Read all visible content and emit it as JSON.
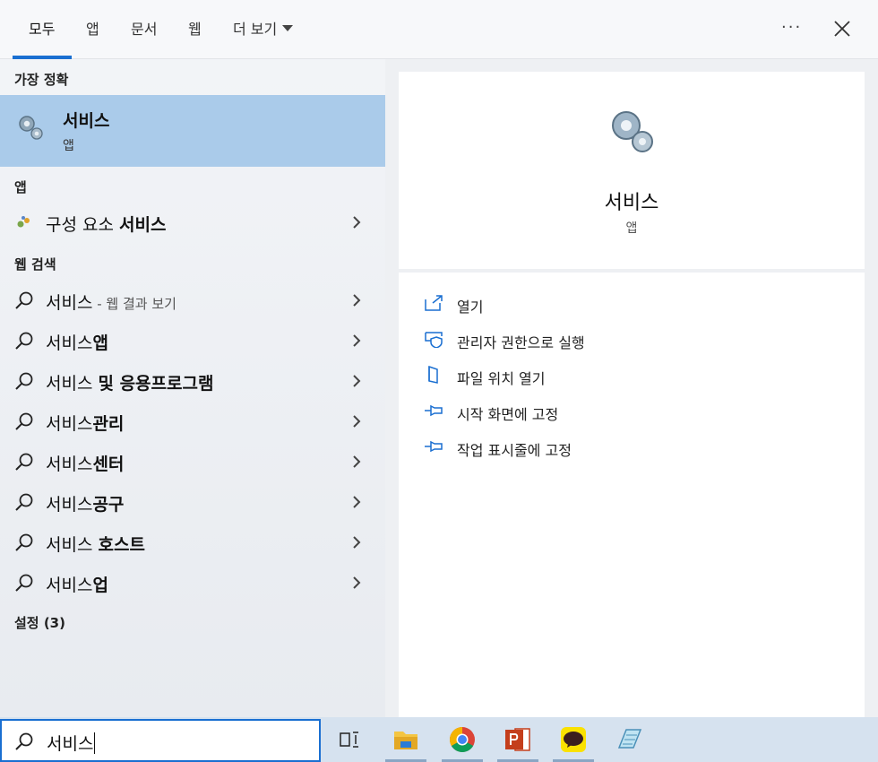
{
  "tabs": [
    {
      "label": "모두",
      "active": true
    },
    {
      "label": "앱"
    },
    {
      "label": "문서"
    },
    {
      "label": "웹"
    },
    {
      "label": "더 보기"
    }
  ],
  "more_label": "···",
  "sections": {
    "best": "가장 정확",
    "apps": "앱",
    "web": "웹 검색",
    "settings": "설정 (3)"
  },
  "best_match": {
    "title": "서비스",
    "subtitle": "앱"
  },
  "app_results": [
    {
      "prefix": "구성 요소 ",
      "bold": "서비스"
    }
  ],
  "web_results": [
    {
      "prefix": "서비스",
      "bold": "",
      "hint": " - 웹 결과 보기"
    },
    {
      "prefix": "서비스",
      "bold": "앱",
      "hint": ""
    },
    {
      "prefix": "서비스 ",
      "bold": "및 응용프로그램",
      "hint": ""
    },
    {
      "prefix": "서비스",
      "bold": "관리",
      "hint": ""
    },
    {
      "prefix": "서비스",
      "bold": "센터",
      "hint": ""
    },
    {
      "prefix": "서비스",
      "bold": "공구",
      "hint": ""
    },
    {
      "prefix": "서비스 ",
      "bold": "호스트",
      "hint": ""
    },
    {
      "prefix": "서비스",
      "bold": "업",
      "hint": ""
    }
  ],
  "preview": {
    "title": "서비스",
    "subtitle": "앱",
    "actions": [
      {
        "label": "열기",
        "icon": "open-icon"
      },
      {
        "label": "관리자 권한으로 실행",
        "icon": "shield-icon"
      },
      {
        "label": "파일 위치 열기",
        "icon": "folder-location-icon"
      },
      {
        "label": "시작 화면에 고정",
        "icon": "pin-icon"
      },
      {
        "label": "작업 표시줄에 고정",
        "icon": "pin-icon"
      }
    ]
  },
  "search": {
    "value": "서비스"
  },
  "taskbar": [
    "task-view-icon",
    "file-explorer-icon",
    "chrome-icon",
    "powerpoint-icon",
    "kakaotalk-icon",
    "notepad-icon"
  ],
  "colors": {
    "accent": "#1a6fd1",
    "selected": "#aacbea"
  }
}
